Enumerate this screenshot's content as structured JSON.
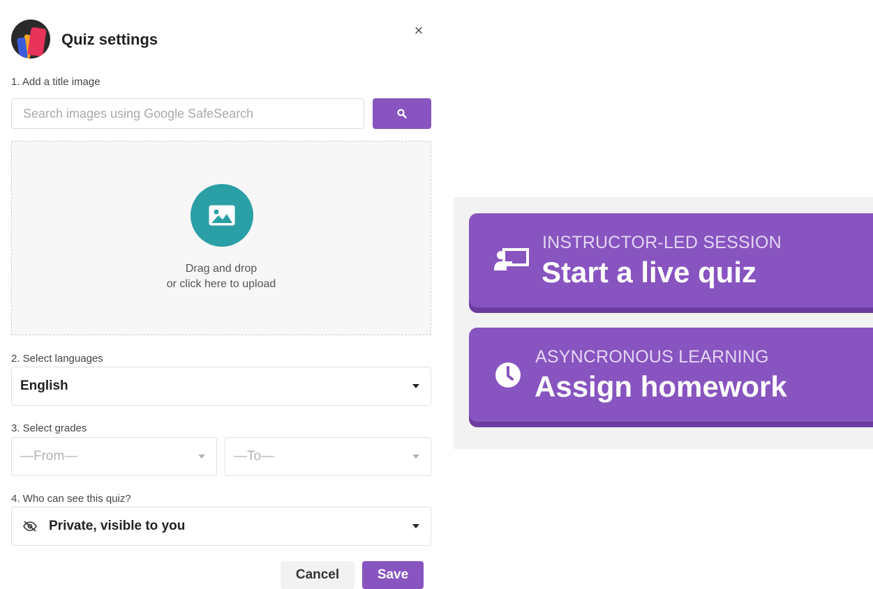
{
  "modal": {
    "title": "Quiz settings",
    "close_glyph": "×",
    "step1_label": "1. Add a title image",
    "search_placeholder": "Search images using Google SafeSearch",
    "drop_line1": "Drag and drop",
    "drop_line2": "or click here to upload",
    "step2_label": "2. Select languages",
    "language_value": "English",
    "step3_label": "3. Select grades",
    "grade_from": "—From—",
    "grade_to": "—To—",
    "step4_label": "4. Who can see this quiz?",
    "visibility_value": "Private, visible to you",
    "cancel_label": "Cancel",
    "save_label": "Save"
  },
  "cards": [
    {
      "kicker": "INSTRUCTOR-LED SESSION",
      "headline": "Start a live quiz",
      "icon": "presentation-icon"
    },
    {
      "kicker": "ASYNCRONOUS LEARNING",
      "headline": "Assign homework",
      "icon": "clock-icon"
    }
  ],
  "colors": {
    "accent": "#8854c0",
    "upload_circle": "#2b9fa6",
    "panel_bg": "#f2f2f2"
  }
}
